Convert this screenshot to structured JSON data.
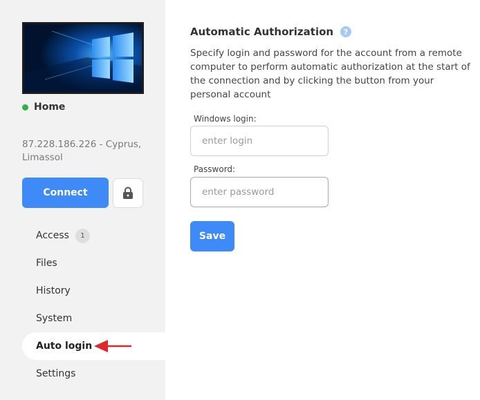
{
  "device": {
    "status_label": "Home",
    "status_color": "#2fb24a",
    "address": "87.228.186.226 - Cyprus, Limassol",
    "connect_label": "Connect",
    "lock_icon": "lock-icon"
  },
  "nav": {
    "items": [
      {
        "label": "Access",
        "badge": "1"
      },
      {
        "label": "Files"
      },
      {
        "label": "History"
      },
      {
        "label": "System"
      },
      {
        "label": "Auto login",
        "active": true
      },
      {
        "label": "Settings"
      }
    ]
  },
  "main": {
    "title": "Automatic Authorization",
    "help_icon": "?",
    "description": "Specify login and password for the account from a remote computer to perform automatic authorization at the start of the connection and by clicking the button from your personal account",
    "login_label": "Windows login:",
    "login_placeholder": "enter login",
    "password_label": "Password:",
    "password_placeholder": "enter password",
    "save_label": "Save"
  },
  "colors": {
    "accent": "#3e8af7",
    "sidebar_bg": "#f2f2f2",
    "arrow": "#e0262b"
  }
}
